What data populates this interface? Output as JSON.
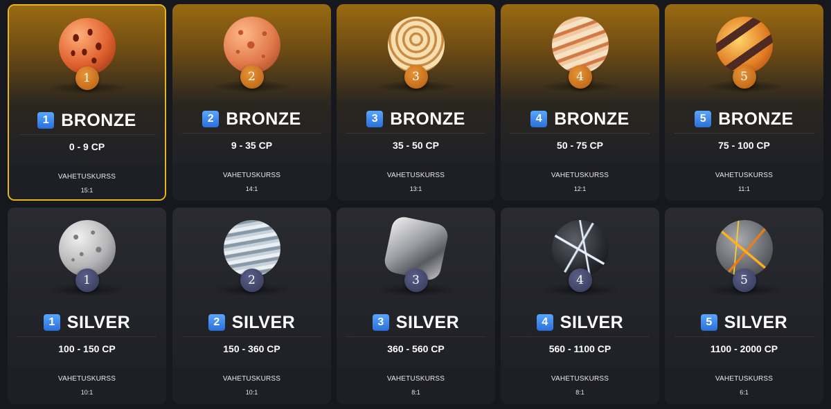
{
  "rate_label": "VAHETUSKURSS",
  "tiers": [
    {
      "level": "1",
      "badge": "1",
      "name": "BRONZE",
      "range": "0 - 9 CP",
      "rate": "15:1",
      "planet_icon": "bronze-planet-1-icon",
      "selected": true
    },
    {
      "level": "2",
      "badge": "2",
      "name": "BRONZE",
      "range": "9 - 35 CP",
      "rate": "14:1",
      "planet_icon": "bronze-planet-2-icon"
    },
    {
      "level": "3",
      "badge": "3",
      "name": "BRONZE",
      "range": "35 - 50 CP",
      "rate": "13:1",
      "planet_icon": "bronze-planet-3-icon"
    },
    {
      "level": "4",
      "badge": "4",
      "name": "BRONZE",
      "range": "50 - 75 CP",
      "rate": "12:1",
      "planet_icon": "bronze-planet-4-icon"
    },
    {
      "level": "5",
      "badge": "5",
      "name": "BRONZE",
      "range": "75 - 100 CP",
      "rate": "11:1",
      "planet_icon": "bronze-planet-5-icon"
    },
    {
      "level": "1",
      "badge": "1",
      "name": "SILVER",
      "range": "100 - 150 CP",
      "rate": "10:1",
      "planet_icon": "silver-planet-1-icon"
    },
    {
      "level": "2",
      "badge": "2",
      "name": "SILVER",
      "range": "150 - 360 CP",
      "rate": "10:1",
      "planet_icon": "silver-planet-2-icon"
    },
    {
      "level": "3",
      "badge": "3",
      "name": "SILVER",
      "range": "360 - 560 CP",
      "rate": "8:1",
      "planet_icon": "silver-planet-3-icon"
    },
    {
      "level": "4",
      "badge": "4",
      "name": "SILVER",
      "range": "560 - 1100 CP",
      "rate": "8:1",
      "planet_icon": "silver-planet-4-icon"
    },
    {
      "level": "5",
      "badge": "5",
      "name": "SILVER",
      "range": "1100 - 2000 CP",
      "rate": "6:1",
      "planet_icon": "silver-planet-5-icon"
    }
  ],
  "colors": {
    "selected_border": "#e7b51f",
    "bronze_glow": "#9a6a12",
    "bronze_badge": "#d8781f",
    "silver_badge": "#45496f",
    "level_box": "#3d8af0",
    "background": "#17181d"
  }
}
